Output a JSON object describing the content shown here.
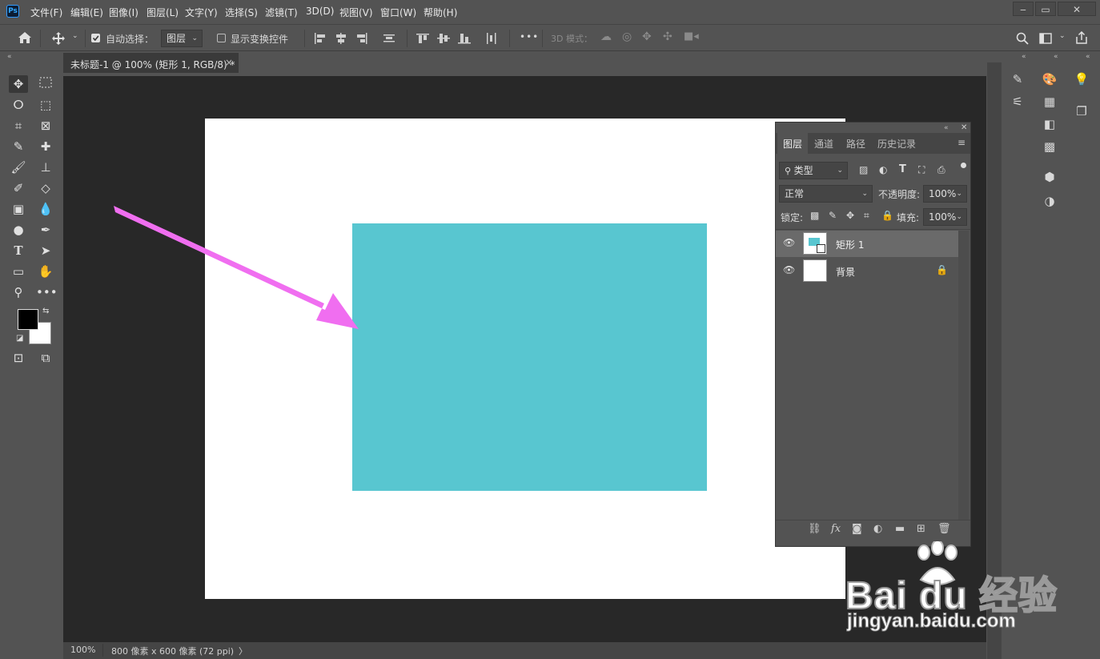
{
  "app": {
    "logo": "Ps"
  },
  "menu": [
    "文件(F)",
    "编辑(E)",
    "图像(I)",
    "图层(L)",
    "文字(Y)",
    "选择(S)",
    "滤镜(T)",
    "3D(D)",
    "视图(V)",
    "窗口(W)",
    "帮助(H)"
  ],
  "window_controls": {
    "minimize": "‒",
    "restore": "▭",
    "close": "✕"
  },
  "options": {
    "auto_select_label": "自动选择：",
    "auto_select_checked": true,
    "auto_select_target": "图层",
    "show_transform_label": "显示变换控件",
    "more": "•••",
    "mode_3d_label": "3D 模式："
  },
  "document": {
    "tab_title": "未标题-1 @ 100% (矩形 1, RGB/8) *",
    "tab_close": "×",
    "zoom": "100%",
    "doc_info": "800 像素 x 600 像素 (72 ppi)",
    "status_arrow": "〉",
    "rect_color": "#58c6d0"
  },
  "arrow_color": "#f06ef0",
  "layers_panel": {
    "tabs": [
      "图层",
      "通道",
      "路径",
      "历史记录"
    ],
    "filter_label": "类型",
    "blend_mode": "正常",
    "opacity_label": "不透明度:",
    "opacity_value": "100%",
    "lock_label": "锁定:",
    "fill_label": "填充:",
    "fill_value": "100%",
    "layers": [
      {
        "name": "矩形 1",
        "selected": true
      },
      {
        "name": "背景",
        "locked": true
      }
    ],
    "footer_icons": [
      "link-icon",
      "fx-icon",
      "mask-icon",
      "adjustment-icon",
      "folder-icon",
      "new-layer-icon",
      "trash-icon"
    ]
  },
  "watermark": {
    "brand": "Bai du 经验",
    "url": "jingyan.baidu.com"
  }
}
